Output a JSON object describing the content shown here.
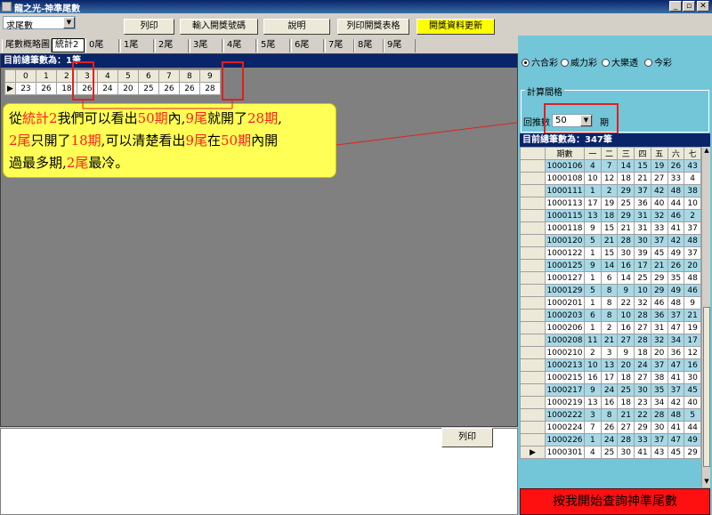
{
  "window": {
    "title": "龍之光-神準尾數"
  },
  "toolbar": {
    "mode_select": "求尾數",
    "print_label": "列印",
    "input_numbers_label": "輸入開獎號碼",
    "help_label": "說明",
    "print_table_label": "列印開獎表格",
    "update_label": "開獎資料更新"
  },
  "tabs": [
    "尾數概略圖",
    "統計2",
    "0尾",
    "1尾",
    "2尾",
    "3尾",
    "4尾",
    "5尾",
    "6尾",
    "7尾",
    "8尾",
    "9尾"
  ],
  "left_grid": {
    "header": "目前總筆數為：1筆",
    "columns": [
      "0",
      "1",
      "2",
      "3",
      "4",
      "5",
      "6",
      "7",
      "8",
      "9"
    ],
    "values": [
      "23",
      "26",
      "18",
      "26",
      "24",
      "20",
      "25",
      "26",
      "26",
      "28"
    ]
  },
  "callout": {
    "line1_a": "從",
    "line1_b": "統計2",
    "line1_c": "我們可以看出",
    "line1_d": "50期",
    "line1_e": "內,",
    "line1_f": "9尾",
    "line1_g": "就開了",
    "line1_h": "28期",
    "line1_i": ",",
    "line2_a": "2尾",
    "line2_b": "只開了",
    "line2_c": "18期",
    "line2_d": ",可以清楚看出",
    "line2_e": "9尾",
    "line2_f": "在",
    "line2_g": "50期",
    "line2_h": "內開",
    "line3_a": "過最多期,",
    "line3_b": "2尾",
    "line3_c": "最冷。"
  },
  "bottom": {
    "print_label": "列印"
  },
  "right_panel": {
    "lotteries": [
      "六合彩",
      "威力彩",
      "大樂透",
      "今彩"
    ],
    "selected_lottery": "六合彩",
    "calc_interval_label": "計算間格",
    "lookback_label": "回推數",
    "lookback_value": "50",
    "period_unit": "期",
    "grid_header": "目前總筆數為：347筆",
    "columns": [
      "期數",
      "一",
      "二",
      "三",
      "四",
      "五",
      "六",
      "七"
    ],
    "rows": [
      [
        "1000106",
        "4",
        "7",
        "14",
        "15",
        "19",
        "26",
        "43"
      ],
      [
        "1000108",
        "10",
        "12",
        "18",
        "21",
        "27",
        "33",
        "4"
      ],
      [
        "1000111",
        "1",
        "2",
        "29",
        "37",
        "42",
        "48",
        "38"
      ],
      [
        "1000113",
        "17",
        "19",
        "25",
        "36",
        "40",
        "44",
        "10"
      ],
      [
        "1000115",
        "13",
        "18",
        "29",
        "31",
        "32",
        "46",
        "2"
      ],
      [
        "1000118",
        "9",
        "15",
        "21",
        "31",
        "33",
        "41",
        "37"
      ],
      [
        "1000120",
        "5",
        "21",
        "28",
        "30",
        "37",
        "42",
        "48"
      ],
      [
        "1000122",
        "1",
        "15",
        "30",
        "39",
        "45",
        "49",
        "37"
      ],
      [
        "1000125",
        "9",
        "14",
        "16",
        "17",
        "21",
        "26",
        "20"
      ],
      [
        "1000127",
        "1",
        "6",
        "14",
        "25",
        "29",
        "35",
        "48"
      ],
      [
        "1000129",
        "5",
        "8",
        "9",
        "10",
        "29",
        "49",
        "46"
      ],
      [
        "1000201",
        "1",
        "8",
        "22",
        "32",
        "46",
        "48",
        "9"
      ],
      [
        "1000203",
        "6",
        "8",
        "10",
        "28",
        "36",
        "37",
        "21"
      ],
      [
        "1000206",
        "1",
        "2",
        "16",
        "27",
        "31",
        "47",
        "19"
      ],
      [
        "1000208",
        "11",
        "21",
        "27",
        "28",
        "32",
        "34",
        "17"
      ],
      [
        "1000210",
        "2",
        "3",
        "9",
        "18",
        "20",
        "36",
        "12"
      ],
      [
        "1000213",
        "10",
        "13",
        "20",
        "24",
        "37",
        "47",
        "16"
      ],
      [
        "1000215",
        "16",
        "17",
        "18",
        "27",
        "38",
        "41",
        "30"
      ],
      [
        "1000217",
        "9",
        "24",
        "25",
        "30",
        "35",
        "37",
        "45"
      ],
      [
        "1000219",
        "13",
        "16",
        "18",
        "23",
        "34",
        "42",
        "40"
      ],
      [
        "1000222",
        "3",
        "8",
        "21",
        "22",
        "28",
        "48",
        "5"
      ],
      [
        "1000224",
        "7",
        "26",
        "27",
        "29",
        "30",
        "41",
        "44"
      ],
      [
        "1000226",
        "1",
        "24",
        "28",
        "33",
        "37",
        "47",
        "49"
      ],
      [
        "1000301",
        "4",
        "25",
        "30",
        "41",
        "43",
        "45",
        "29"
      ]
    ],
    "query_button": "按我開始查詢神準尾數"
  }
}
